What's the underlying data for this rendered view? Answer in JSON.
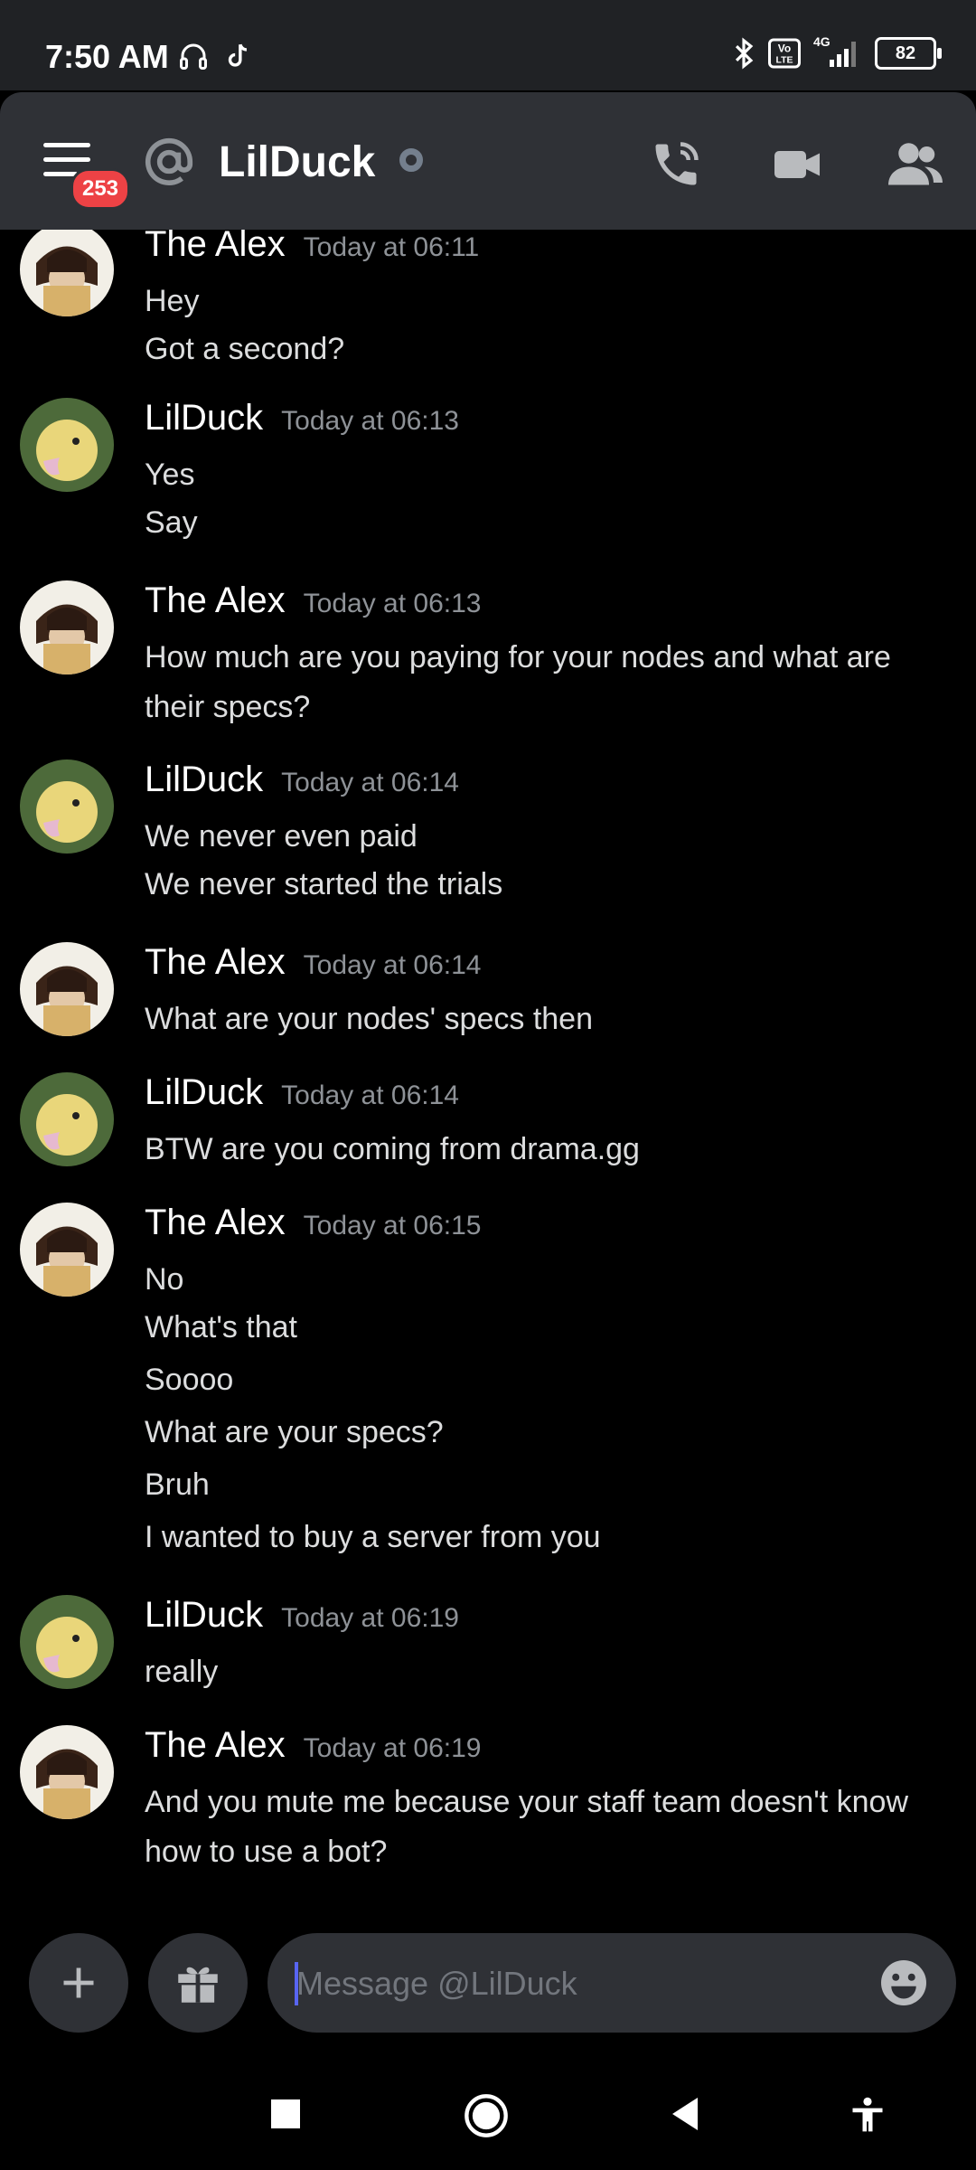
{
  "status_bar": {
    "time": "7:50 AM",
    "battery": "82",
    "network": "4G"
  },
  "header": {
    "badge_count": "253",
    "channel_name": "LilDuck"
  },
  "messages": [
    {
      "author": "The Alex",
      "time": "Today at 06:11",
      "lines": [
        "Hey",
        "Got a second?"
      ]
    },
    {
      "author": "LilDuck",
      "time": "Today at 06:13",
      "lines": [
        "Yes",
        "Say"
      ]
    },
    {
      "author": "The Alex",
      "time": "Today at 06:13",
      "lines": [
        "How much are you paying for your nodes and what are",
        "their specs?"
      ]
    },
    {
      "author": "LilDuck",
      "time": "Today at 06:14",
      "lines": [
        "We never even paid",
        "We never started the trials"
      ]
    },
    {
      "author": "The Alex",
      "time": "Today at 06:14",
      "lines": [
        "What are your nodes' specs then"
      ]
    },
    {
      "author": "LilDuck",
      "time": "Today at 06:14",
      "lines": [
        "BTW are you coming from drama.gg"
      ]
    },
    {
      "author": "The Alex",
      "time": "Today at 06:15",
      "lines": [
        "No",
        "What's that",
        "Soooo",
        "What are your specs?",
        "Bruh",
        "I wanted to buy a server from you"
      ]
    },
    {
      "author": "LilDuck",
      "time": "Today at 06:19",
      "lines": [
        "really"
      ]
    },
    {
      "author": "The Alex",
      "time": "Today at 06:19",
      "lines": [
        "And you mute me because your staff team doesn't know",
        "how to use a bot?"
      ]
    }
  ],
  "composer": {
    "placeholder": "Message @LilDuck"
  },
  "colors": {
    "background": "#000000",
    "header": "#2f3136",
    "badge": "#ed4245",
    "accent": "#5865f2"
  },
  "icons": [
    "hamburger-menu-icon",
    "at-sign-icon",
    "phone-call-icon",
    "video-camera-icon",
    "members-icon",
    "plus-icon",
    "gift-icon",
    "emoji-icon",
    "nav-square-icon",
    "nav-home-icon",
    "nav-back-icon",
    "accessibility-icon"
  ]
}
